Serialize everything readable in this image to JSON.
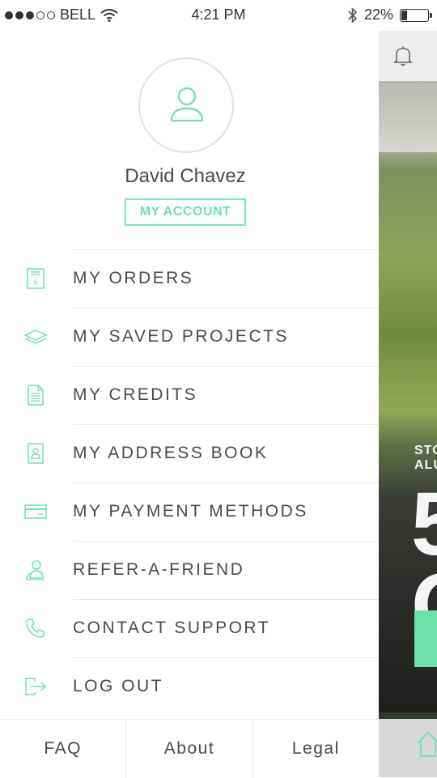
{
  "status_bar": {
    "carrier": "BELL",
    "time": "4:21 PM",
    "battery": "22%",
    "battery_level": 0.22,
    "signal_bars_filled": 3,
    "signal_bars_total": 5
  },
  "profile": {
    "name": "David Chavez",
    "account_button": "MY ACCOUNT"
  },
  "menu": {
    "items": [
      {
        "label": "MY ORDERS",
        "icon": "receipt-icon"
      },
      {
        "label": "MY SAVED PROJECTS",
        "icon": "layers-icon"
      },
      {
        "label": "MY CREDITS",
        "icon": "document-icon"
      },
      {
        "label": "MY ADDRESS BOOK",
        "icon": "address-book-icon"
      },
      {
        "label": "MY PAYMENT METHODS",
        "icon": "credit-card-icon"
      },
      {
        "label": "REFER-A-FRIEND",
        "icon": "users-icon"
      },
      {
        "label": "CONTACT SUPPORT",
        "icon": "phone-icon"
      },
      {
        "label": "LOG OUT",
        "icon": "logout-icon"
      }
    ]
  },
  "footer": {
    "faq": "FAQ",
    "about": "About",
    "legal": "Legal"
  },
  "background_peek": {
    "line1": "STO",
    "line2": "ALU",
    "big_text": "5",
    "big_text2": "O"
  },
  "colors": {
    "accent": "#6fe0b1",
    "text": "#4a4a4a",
    "divider": "#e8e8e8"
  }
}
